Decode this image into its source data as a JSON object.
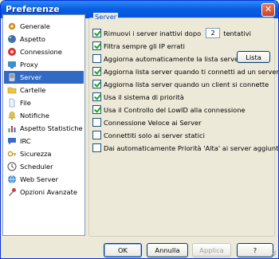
{
  "window": {
    "title": "Preferenze",
    "close_glyph": "✕"
  },
  "sidebar": {
    "selected": "Server",
    "items": [
      {
        "label": "Generale",
        "icon": "gear-icon",
        "color": "#D9861A"
      },
      {
        "label": "Aspetto",
        "icon": "palette-icon",
        "color": "#2E6FC8"
      },
      {
        "label": "Connessione",
        "icon": "connection-icon",
        "color": "#D42F2F"
      },
      {
        "label": "Proxy",
        "icon": "proxy-icon",
        "color": "#3A8FD0"
      },
      {
        "label": "Server",
        "icon": "server-icon",
        "color": "#9AA4B0"
      },
      {
        "label": "Cartelle",
        "icon": "folder-icon",
        "color": "#E8C440"
      },
      {
        "label": "File",
        "icon": "file-icon",
        "color": "#7FA8D8"
      },
      {
        "label": "Notifiche",
        "icon": "notification-icon",
        "color": "#C8A020"
      },
      {
        "label": "Aspetto Statistiche",
        "icon": "statistics-icon",
        "color": "#3AA04A"
      },
      {
        "label": "IRC",
        "icon": "irc-icon",
        "color": "#3C6CC8"
      },
      {
        "label": "Sicurezza",
        "icon": "security-icon",
        "color": "#E0B030"
      },
      {
        "label": "Scheduler",
        "icon": "scheduler-icon",
        "color": "#4A4A4A"
      },
      {
        "label": "Web Server",
        "icon": "web-server-icon",
        "color": "#3A88D0"
      },
      {
        "label": "Opzioni Avanzate",
        "icon": "advanced-options-icon",
        "color": "#D04040"
      }
    ]
  },
  "server_group": {
    "legend": "Server",
    "options": [
      {
        "label": "Rimuovi i server inattivi dopo",
        "checked": true,
        "value": "2",
        "suffix": "tentativi"
      },
      {
        "label": "Filtra sempre gli IP errati",
        "checked": true
      },
      {
        "label": "Aggiorna automaticamente la lista server all'avvio",
        "checked": false,
        "button": "Lista"
      },
      {
        "label": "Aggiorna lista server quando ti connetti ad un server",
        "checked": true
      },
      {
        "label": "Aggiorna lista server quando un client si connette",
        "checked": true
      },
      {
        "label": "Usa il sistema di priorità",
        "checked": true
      },
      {
        "label": "Usa il Controllo del LowID alla connessione",
        "checked": true
      },
      {
        "label": "Connessione Veloce ai Server",
        "checked": false
      },
      {
        "label": "Connettiti solo ai server statici",
        "checked": false
      },
      {
        "label": "Dai automaticamente Priorità 'Alta' ai server aggiunti",
        "checked": false
      }
    ]
  },
  "footer": {
    "ok": "OK",
    "cancel": "Annulla",
    "apply": "Applica",
    "help": "?"
  }
}
